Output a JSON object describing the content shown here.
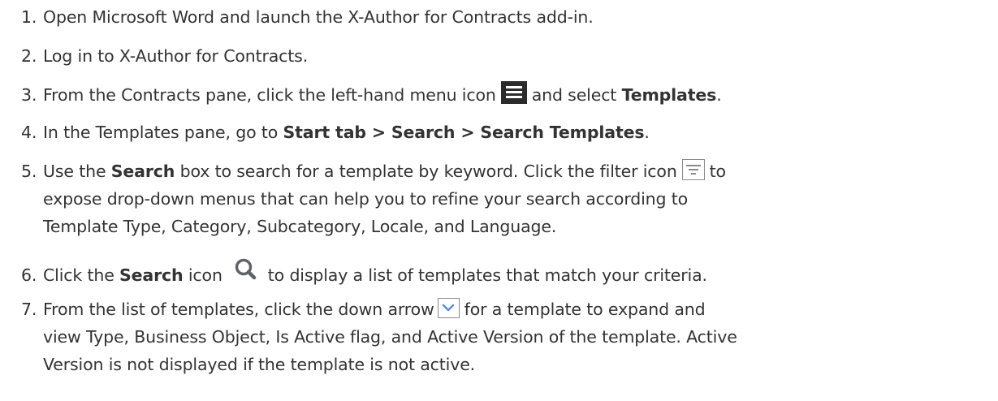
{
  "steps": [
    {
      "num": "1.",
      "text": "Open Microsoft Word and launch the X-Author for Contracts add-in."
    },
    {
      "num": "2.",
      "text": "Log in to X-Author for Contracts."
    },
    {
      "num": "3.",
      "pre": "From the Contracts pane, click the left-hand menu icon",
      "icon": "menu-icon",
      "mid": "and select",
      "bold": "Templates",
      "post": "."
    },
    {
      "num": "4.",
      "pre": "In the Templates pane, go to",
      "bold": "Start tab > Search > Search Templates",
      "post": "."
    },
    {
      "num": "5.",
      "pre": "Use the",
      "bold": "Search",
      "mid": "box to search for a template by keyword. Click the filter icon",
      "icon": "filter-icon",
      "post": "to",
      "line2": "expose drop-down menus that can help you to refine your search according to",
      "line3": "Template Type, Category, Subcategory, Locale, and Language."
    },
    {
      "num": "6.",
      "pre": "Click the",
      "bold": "Search",
      "mid": "icon",
      "icon": "search-icon",
      "post": "to display a list of templates that match your criteria."
    },
    {
      "num": "7.",
      "pre": "From the list of templates, click the down arrow",
      "icon": "chevron-down-icon",
      "post": "for a template to expand and",
      "line2": "view Type, Business Object, Is Active flag, and Active Version of the template. Active",
      "line3": "Version is not displayed if the template is not active."
    }
  ]
}
